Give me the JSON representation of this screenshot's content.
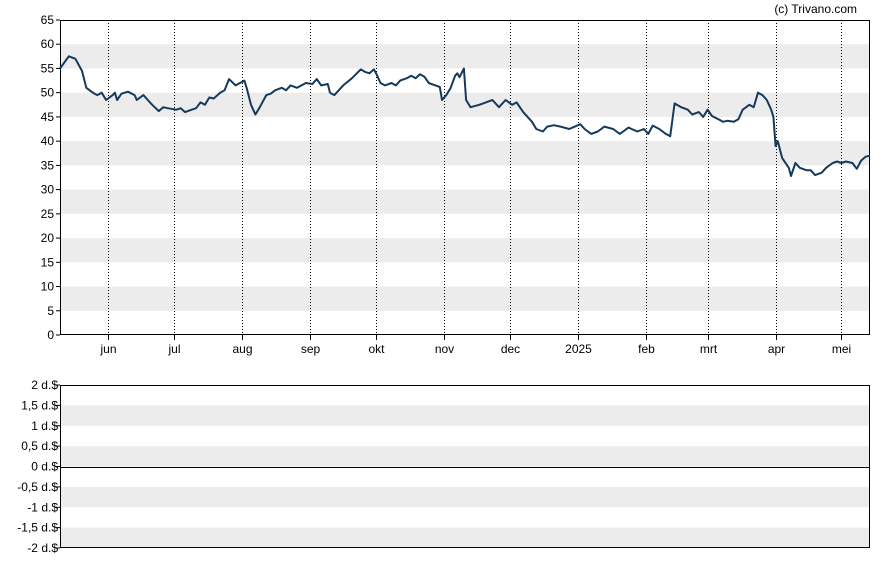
{
  "watermark": "(c) Trivano.com",
  "colors": {
    "line": "#153a5b",
    "band": "#ececec",
    "grid": "#000000",
    "zero": "#000000"
  },
  "chart_data": [
    {
      "type": "line",
      "title": "",
      "xlabel": "",
      "ylabel": "",
      "ylim": [
        0,
        65
      ],
      "y_ticks": [
        0,
        5,
        10,
        15,
        20,
        25,
        30,
        35,
        40,
        45,
        50,
        55,
        60,
        65
      ],
      "x_range": [
        "2024-05-10",
        "2025-05-14"
      ],
      "x_ticks": [
        {
          "date": "2024-06-01",
          "label": "jun"
        },
        {
          "date": "2024-07-01",
          "label": "jul"
        },
        {
          "date": "2024-08-01",
          "label": "aug"
        },
        {
          "date": "2024-09-01",
          "label": "sep"
        },
        {
          "date": "2024-10-01",
          "label": "okt"
        },
        {
          "date": "2024-11-01",
          "label": "nov"
        },
        {
          "date": "2024-12-01",
          "label": "dec"
        },
        {
          "date": "2025-01-01",
          "label": "2025"
        },
        {
          "date": "2025-02-01",
          "label": "feb"
        },
        {
          "date": "2025-03-01",
          "label": "mrt"
        },
        {
          "date": "2025-04-01",
          "label": "apr"
        },
        {
          "date": "2025-05-01",
          "label": "mei"
        }
      ],
      "grid": "vertical dotted lines at month starts, alternating horizontal bands",
      "series": [
        {
          "points": [
            [
              "2024-05-10",
              55.0
            ],
            [
              "2024-05-14",
              57.5
            ],
            [
              "2024-05-17",
              57.0
            ],
            [
              "2024-05-20",
              54.5
            ],
            [
              "2024-05-22",
              51.0
            ],
            [
              "2024-05-25",
              50.0
            ],
            [
              "2024-05-27",
              49.5
            ],
            [
              "2024-05-29",
              50.0
            ],
            [
              "2024-05-31",
              48.5
            ],
            [
              "2024-06-03",
              49.5
            ],
            [
              "2024-06-04",
              50.0
            ],
            [
              "2024-06-05",
              48.5
            ],
            [
              "2024-06-07",
              49.8
            ],
            [
              "2024-06-10",
              50.2
            ],
            [
              "2024-06-13",
              49.5
            ],
            [
              "2024-06-14",
              48.5
            ],
            [
              "2024-06-17",
              49.5
            ],
            [
              "2024-06-19",
              48.5
            ],
            [
              "2024-06-21",
              47.5
            ],
            [
              "2024-06-24",
              46.2
            ],
            [
              "2024-06-26",
              47.0
            ],
            [
              "2024-06-28",
              46.8
            ],
            [
              "2024-07-02",
              46.5
            ],
            [
              "2024-07-04",
              46.8
            ],
            [
              "2024-07-06",
              46.0
            ],
            [
              "2024-07-09",
              46.5
            ],
            [
              "2024-07-11",
              46.8
            ],
            [
              "2024-07-13",
              48.0
            ],
            [
              "2024-07-15",
              47.5
            ],
            [
              "2024-07-17",
              49.0
            ],
            [
              "2024-07-19",
              48.8
            ],
            [
              "2024-07-22",
              50.0
            ],
            [
              "2024-07-24",
              50.5
            ],
            [
              "2024-07-26",
              52.8
            ],
            [
              "2024-07-29",
              51.5
            ],
            [
              "2024-07-31",
              52.0
            ],
            [
              "2024-08-02",
              52.5
            ],
            [
              "2024-08-03",
              51.0
            ],
            [
              "2024-08-05",
              47.5
            ],
            [
              "2024-08-07",
              45.5
            ],
            [
              "2024-08-09",
              47.0
            ],
            [
              "2024-08-12",
              49.5
            ],
            [
              "2024-08-14",
              49.8
            ],
            [
              "2024-08-16",
              50.5
            ],
            [
              "2024-08-19",
              51.0
            ],
            [
              "2024-08-21",
              50.5
            ],
            [
              "2024-08-23",
              51.5
            ],
            [
              "2024-08-26",
              51.0
            ],
            [
              "2024-08-28",
              51.5
            ],
            [
              "2024-08-30",
              52.0
            ],
            [
              "2024-09-02",
              51.8
            ],
            [
              "2024-09-04",
              52.8
            ],
            [
              "2024-09-06",
              51.5
            ],
            [
              "2024-09-09",
              51.8
            ],
            [
              "2024-09-10",
              50.0
            ],
            [
              "2024-09-12",
              49.5
            ],
            [
              "2024-09-16",
              51.5
            ],
            [
              "2024-09-20",
              53.0
            ],
            [
              "2024-09-24",
              54.8
            ],
            [
              "2024-09-26",
              54.3
            ],
            [
              "2024-09-28",
              54.0
            ],
            [
              "2024-09-30",
              54.8
            ],
            [
              "2024-10-01",
              54.0
            ],
            [
              "2024-10-03",
              52.0
            ],
            [
              "2024-10-05",
              51.5
            ],
            [
              "2024-10-08",
              52.0
            ],
            [
              "2024-10-10",
              51.5
            ],
            [
              "2024-10-12",
              52.5
            ],
            [
              "2024-10-15",
              53.0
            ],
            [
              "2024-10-17",
              53.5
            ],
            [
              "2024-10-19",
              53.0
            ],
            [
              "2024-10-21",
              53.8
            ],
            [
              "2024-10-23",
              53.3
            ],
            [
              "2024-10-25",
              52.0
            ],
            [
              "2024-10-28",
              51.5
            ],
            [
              "2024-10-30",
              51.2
            ],
            [
              "2024-10-31",
              48.5
            ],
            [
              "2024-11-02",
              49.5
            ],
            [
              "2024-11-04",
              51.0
            ],
            [
              "2024-11-06",
              53.5
            ],
            [
              "2024-11-07",
              54.0
            ],
            [
              "2024-11-08",
              53.2
            ],
            [
              "2024-11-10",
              55.0
            ],
            [
              "2024-11-11",
              48.5
            ],
            [
              "2024-11-13",
              47.0
            ],
            [
              "2024-11-17",
              47.5
            ],
            [
              "2024-11-20",
              48.0
            ],
            [
              "2024-11-23",
              48.5
            ],
            [
              "2024-11-26",
              47.0
            ],
            [
              "2024-11-29",
              48.5
            ],
            [
              "2024-12-02",
              47.5
            ],
            [
              "2024-12-04",
              48.0
            ],
            [
              "2024-12-07",
              46.0
            ],
            [
              "2024-12-09",
              45.0
            ],
            [
              "2024-12-11",
              44.0
            ],
            [
              "2024-12-13",
              42.5
            ],
            [
              "2024-12-16",
              42.0
            ],
            [
              "2024-12-18",
              43.0
            ],
            [
              "2024-12-21",
              43.3
            ],
            [
              "2024-12-24",
              43.0
            ],
            [
              "2024-12-28",
              42.5
            ],
            [
              "2025-01-02",
              43.5
            ],
            [
              "2025-01-04",
              42.5
            ],
            [
              "2025-01-07",
              41.5
            ],
            [
              "2025-01-10",
              42.0
            ],
            [
              "2025-01-13",
              43.0
            ],
            [
              "2025-01-17",
              42.5
            ],
            [
              "2025-01-20",
              41.5
            ],
            [
              "2025-01-24",
              42.8
            ],
            [
              "2025-01-28",
              42.0
            ],
            [
              "2025-01-31",
              42.5
            ],
            [
              "2025-02-02",
              41.5
            ],
            [
              "2025-02-04",
              43.2
            ],
            [
              "2025-02-07",
              42.5
            ],
            [
              "2025-02-10",
              41.5
            ],
            [
              "2025-02-12",
              41.0
            ],
            [
              "2025-02-14",
              47.8
            ],
            [
              "2025-02-17",
              47.0
            ],
            [
              "2025-02-20",
              46.5
            ],
            [
              "2025-02-22",
              45.5
            ],
            [
              "2025-02-25",
              46.0
            ],
            [
              "2025-02-27",
              45.0
            ],
            [
              "2025-03-01",
              46.5
            ],
            [
              "2025-03-03",
              45.2
            ],
            [
              "2025-03-06",
              44.5
            ],
            [
              "2025-03-08",
              44.0
            ],
            [
              "2025-03-10",
              44.2
            ],
            [
              "2025-03-13",
              44.0
            ],
            [
              "2025-03-15",
              44.5
            ],
            [
              "2025-03-17",
              46.5
            ],
            [
              "2025-03-20",
              47.5
            ],
            [
              "2025-03-22",
              47.0
            ],
            [
              "2025-03-24",
              50.0
            ],
            [
              "2025-03-26",
              49.5
            ],
            [
              "2025-03-28",
              48.5
            ],
            [
              "2025-03-30",
              46.5
            ],
            [
              "2025-03-31",
              45.0
            ],
            [
              "2025-04-01",
              39.0
            ],
            [
              "2025-04-02",
              40.0
            ],
            [
              "2025-04-04",
              36.5
            ],
            [
              "2025-04-07",
              34.5
            ],
            [
              "2025-04-08",
              32.8
            ],
            [
              "2025-04-10",
              35.5
            ],
            [
              "2025-04-12",
              34.5
            ],
            [
              "2025-04-15",
              34.0
            ],
            [
              "2025-04-17",
              34.0
            ],
            [
              "2025-04-19",
              33.0
            ],
            [
              "2025-04-22",
              33.5
            ],
            [
              "2025-04-24",
              34.5
            ],
            [
              "2025-04-27",
              35.5
            ],
            [
              "2025-04-29",
              35.8
            ],
            [
              "2025-05-01",
              35.5
            ],
            [
              "2025-05-03",
              35.8
            ],
            [
              "2025-05-06",
              35.5
            ],
            [
              "2025-05-08",
              34.3
            ],
            [
              "2025-05-10",
              36.0
            ],
            [
              "2025-05-12",
              36.8
            ],
            [
              "2025-05-14",
              37.0
            ]
          ]
        }
      ]
    },
    {
      "type": "bar",
      "title": "",
      "xlabel": "",
      "ylabel": "",
      "ylim": [
        -2,
        2
      ],
      "y_ticks": [
        {
          "value": 2,
          "label": "2 d.$"
        },
        {
          "value": 1.5,
          "label": "1,5 d.$"
        },
        {
          "value": 1,
          "label": "1 d.$"
        },
        {
          "value": 0.5,
          "label": "0,5 d.$"
        },
        {
          "value": 0,
          "label": "0 d.$"
        },
        {
          "value": -0.5,
          "label": "-0,5 d.$"
        },
        {
          "value": -1,
          "label": "-1 d.$"
        },
        {
          "value": -1.5,
          "label": "-1,5 d.$"
        },
        {
          "value": -2,
          "label": "-2 d.$"
        }
      ],
      "values": []
    }
  ]
}
